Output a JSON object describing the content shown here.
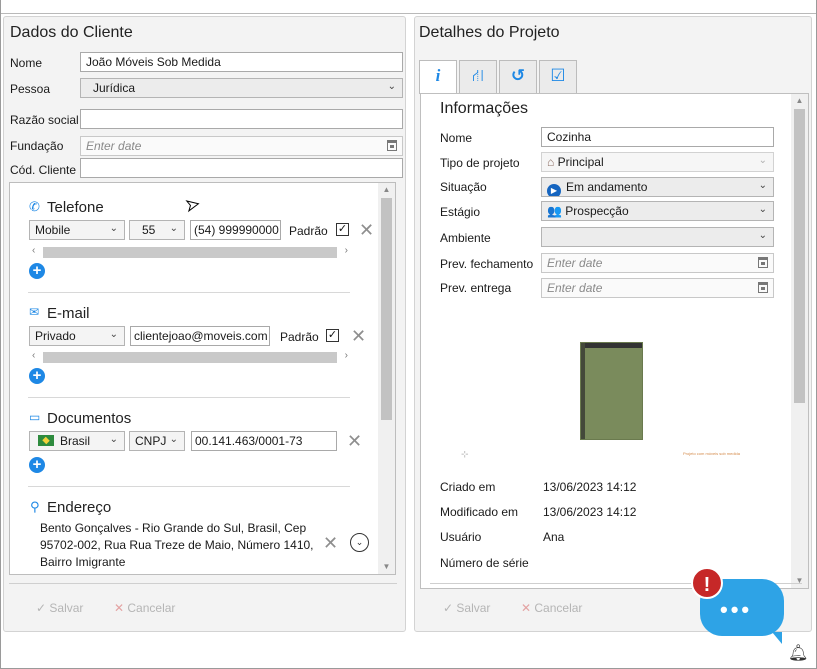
{
  "left_panel": {
    "title": "Dados do Cliente",
    "fields": {
      "nome_label": "Nome",
      "nome_value": "João Móveis Sob Medida",
      "pessoa_label": "Pessoa",
      "pessoa_value": "Jurídica",
      "razao_label": "Razão social",
      "razao_value": "",
      "fundacao_label": "Fundação",
      "fundacao_placeholder": "Enter date",
      "cod_label": "Cód. Cliente",
      "cod_value": ""
    },
    "telefone": {
      "title": "Telefone",
      "type": "Mobile",
      "ddi": "55",
      "number": "(54) 999990000",
      "padrao_label": "Padrão",
      "padrao_checked": "✓"
    },
    "email": {
      "title": "E-mail",
      "type": "Privado",
      "value": "clientejoao@moveis.com",
      "padrao_label": "Padrão",
      "padrao_checked": "✓"
    },
    "documentos": {
      "title": "Documentos",
      "country": "Brasil",
      "doc_type": "CNPJ",
      "number": "00.141.463/0001-73"
    },
    "endereco": {
      "title": "Endereço",
      "line1": "Bento Gonçalves - Rio Grande do Sul, Brasil, Cep",
      "line2": "95702-002, Rua Rua Treze de Maio, Número 1410,",
      "line3": "Bairro Imigrante"
    },
    "footer": {
      "salvar": "Salvar",
      "cancelar": "Cancelar"
    }
  },
  "right_panel": {
    "title": "Detalhes do Projeto",
    "tabs": [
      {
        "icon": "info-icon",
        "glyph": "i"
      },
      {
        "icon": "hierarchy-icon",
        "glyph": "⛙"
      },
      {
        "icon": "history-icon",
        "glyph": "↺"
      },
      {
        "icon": "checklist-icon",
        "glyph": "☑"
      }
    ],
    "info": {
      "title": "Informações",
      "nome_label": "Nome",
      "nome_value": "Cozinha",
      "tipo_label": "Tipo de projeto",
      "tipo_value": "Principal",
      "situacao_label": "Situação",
      "situacao_value": "Em andamento",
      "estagio_label": "Estágio",
      "estagio_value": "Prospecção",
      "ambiente_label": "Ambiente",
      "ambiente_value": "",
      "prev_fech_label": "Prev. fechamento",
      "prev_fech_placeholder": "Enter date",
      "prev_entrega_label": "Prev. entrega",
      "prev_entrega_placeholder": "Enter date",
      "criado_label": "Criado em",
      "criado_value": "13/06/2023 14:12",
      "modificado_label": "Modificado em",
      "modificado_value": "13/06/2023 14:12",
      "usuario_label": "Usuário",
      "usuario_value": "Ana",
      "serie_label": "Número de série",
      "serie_value": "",
      "thumb_caption": "Projeto com móveis sob medida"
    },
    "footer": {
      "salvar": "Salvar",
      "cancelar": "Cancelar"
    }
  },
  "notifications": {
    "alert_badge": "!",
    "chat_dots": "•••"
  },
  "colors": {
    "accent_blue": "#1e88e5",
    "chat_blue": "#2ea3e6",
    "alert_red": "#c62828"
  }
}
